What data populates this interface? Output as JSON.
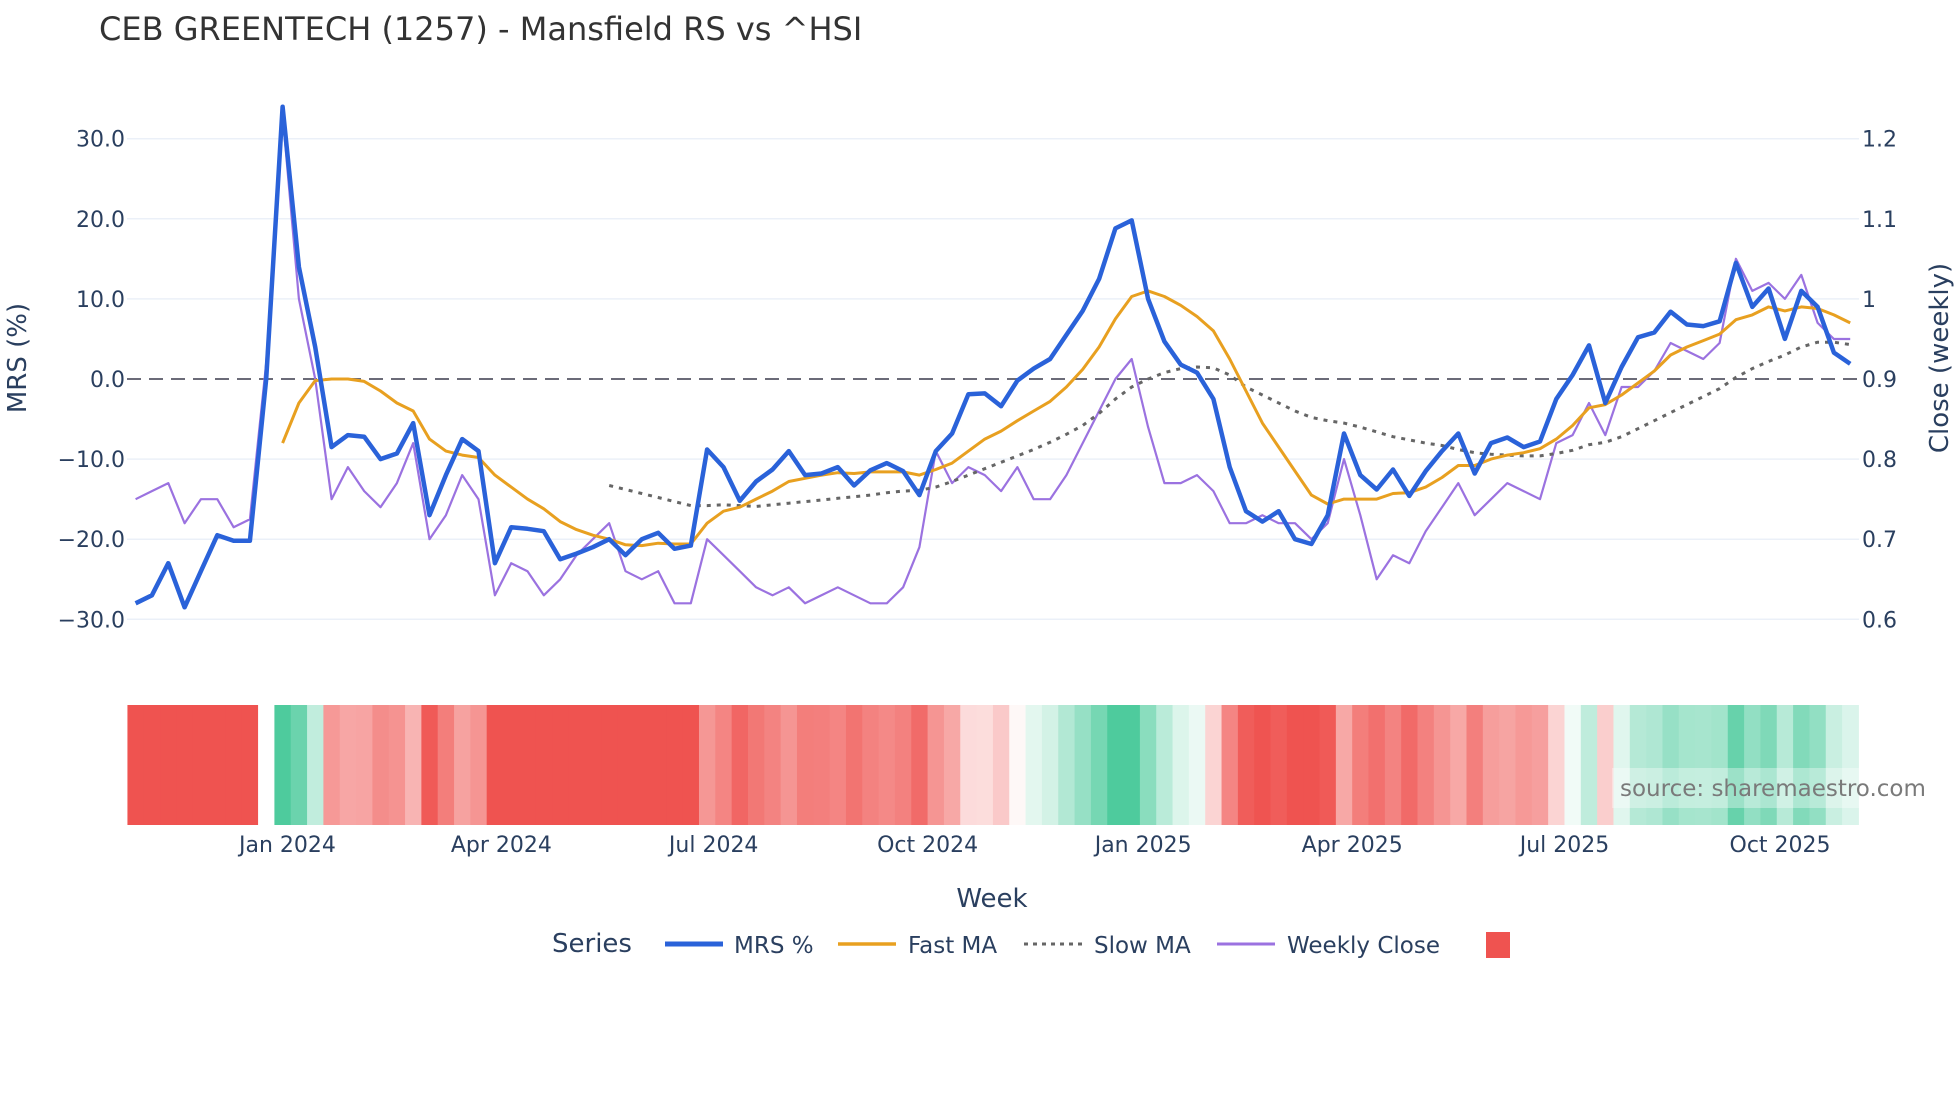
{
  "chart_data": {
    "type": "line",
    "title": "CEB GREENTECH (1257) - Mansfield RS vs ^HSI",
    "xlabel": "Week",
    "ylabel": "MRS (%)",
    "y2label": "Close (weekly)",
    "ylim": [
      -36,
      36
    ],
    "y2lim": [
      0.55,
      1.25
    ],
    "yticks": [
      "30.0",
      "20.0",
      "10.0",
      "0.0",
      "−10.0",
      "−20.0",
      "−30.0"
    ],
    "ytick_values": [
      30,
      20,
      10,
      0,
      -10,
      -20,
      -30
    ],
    "y2ticks": [
      "1.2",
      "1.1",
      "1",
      "0.9",
      "0.8",
      "0.7",
      "0.6"
    ],
    "y2tick_values": [
      1.2,
      1.1,
      1.0,
      0.9,
      0.8,
      0.7,
      0.6
    ],
    "xticks": [
      {
        "label": "Jan 2024",
        "week": 9.3
      },
      {
        "label": "Apr 2024",
        "week": 22.4
      },
      {
        "label": "Jul 2024",
        "week": 35.4
      },
      {
        "label": "Oct 2024",
        "week": 48.5
      },
      {
        "label": "Jan 2025",
        "week": 61.7
      },
      {
        "label": "Apr 2025",
        "week": 74.5
      },
      {
        "label": "Jul 2025",
        "week": 87.5
      },
      {
        "label": "Oct 2025",
        "week": 100.7
      }
    ],
    "zero_line": 0,
    "grid": true,
    "legend": {
      "title": "Series",
      "placement": "bottom-center"
    },
    "annotation": "source: sharemaestro.com",
    "series": [
      {
        "name": "MRS %",
        "color": "#2a62d9",
        "axis": "left",
        "start": 0,
        "values": [
          -28,
          -27,
          -23,
          -28.5,
          -24,
          -19.5,
          -20.2,
          -20.2,
          0,
          34,
          14,
          4,
          -8.5,
          -7,
          -7.2,
          -10,
          -9.3,
          -5.5,
          -17,
          -12,
          -7.5,
          -9,
          -23,
          -18.5,
          -18.7,
          -19,
          -22.5,
          -21.8,
          -21,
          -20,
          -22,
          -20,
          -19.2,
          -21.2,
          -20.8,
          -8.8,
          -11,
          -15.2,
          -12.8,
          -11.3,
          -9,
          -12,
          -11.8,
          -11,
          -13.3,
          -11.4,
          -10.5,
          -11.5,
          -14.5,
          -9,
          -6.8,
          -1.9,
          -1.8,
          -3.4,
          -0.2,
          1.3,
          2.5,
          5.5,
          8.5,
          12.5,
          18.8,
          19.8,
          10,
          4.7,
          1.8,
          0.8,
          -2.5,
          -11,
          -16.5,
          -17.8,
          -16.5,
          -20,
          -20.6,
          -17,
          -6.8,
          -12,
          -13.8,
          -11.3,
          -14.6,
          -11.5,
          -9,
          -6.8,
          -11.8,
          -8,
          -7.3,
          -8.5,
          -7.8,
          -2.5,
          0.5,
          4.2,
          -3,
          1.5,
          5.2,
          5.8,
          8.4,
          6.8,
          6.6,
          7.2,
          14.5,
          9,
          11.3,
          5,
          11,
          9,
          3.3,
          1.9
        ]
      },
      {
        "name": "Fast MA",
        "color": "#e8a020",
        "axis": "left",
        "start": 9,
        "values": [
          -8,
          -3,
          -0.2,
          0,
          0,
          -0.3,
          -1.5,
          -3,
          -4,
          -7.5,
          -9,
          -9.5,
          -9.8,
          -12,
          -13.5,
          -15,
          -16.2,
          -17.8,
          -18.8,
          -19.5,
          -20,
          -20.7,
          -20.8,
          -20.5,
          -20.6,
          -20.6,
          -18,
          -16.5,
          -16,
          -15,
          -14,
          -12.8,
          -12.4,
          -12,
          -11.7,
          -11.8,
          -11.6,
          -11.6,
          -11.6,
          -12,
          -11.3,
          -10.5,
          -9,
          -7.5,
          -6.5,
          -5.2,
          -4,
          -2.8,
          -1,
          1.2,
          4,
          7.5,
          10.3,
          11,
          10.3,
          9.2,
          7.8,
          6,
          2.5,
          -1.5,
          -5.5,
          -8.5,
          -11.5,
          -14.5,
          -15.6,
          -15,
          -15,
          -15,
          -14.3,
          -14.2,
          -13.5,
          -12.3,
          -10.8,
          -10.8,
          -10,
          -9.5,
          -9.2,
          -8.7,
          -7.5,
          -5.8,
          -3.6,
          -3.2,
          -2,
          -0.5,
          1,
          3,
          4,
          4.8,
          5.6,
          7.4,
          8,
          9,
          8.5,
          9,
          8.8,
          8,
          7
        ]
      },
      {
        "name": "Slow MA",
        "color": "#666666",
        "axis": "left",
        "start": 29,
        "dash": "dot",
        "values": [
          -13.3,
          -13.8,
          -14.3,
          -14.8,
          -15.3,
          -15.8,
          -15.8,
          -15.7,
          -15.8,
          -15.9,
          -15.7,
          -15.5,
          -15.3,
          -15.1,
          -14.9,
          -14.7,
          -14.5,
          -14.2,
          -14,
          -13.9,
          -13.5,
          -12.8,
          -12,
          -11.2,
          -10.4,
          -9.6,
          -8.8,
          -7.9,
          -6.9,
          -5.8,
          -4.3,
          -2.5,
          -1,
          0,
          0.8,
          1.3,
          1.5,
          1.4,
          0.5,
          -1,
          -2,
          -3,
          -4,
          -4.8,
          -5.2,
          -5.5,
          -6,
          -6.6,
          -7.2,
          -7.6,
          -8,
          -8.3,
          -8.8,
          -9.2,
          -9.4,
          -9.5,
          -9.6,
          -9.6,
          -9.3,
          -8.9,
          -8.2,
          -7.9,
          -7.2,
          -6.2,
          -5.2,
          -4.2,
          -3.2,
          -2.2,
          -1.2,
          0.2,
          1.3,
          2.2,
          3,
          4,
          4.6,
          4.6,
          4.3
        ]
      },
      {
        "name": "Weekly Close",
        "color": "#9b72e0",
        "axis": "right",
        "start": 0,
        "values": [
          0.75,
          0.76,
          0.77,
          0.72,
          0.75,
          0.75,
          0.715,
          0.725,
          0.92,
          1.23,
          1.0,
          0.9,
          0.75,
          0.79,
          0.76,
          0.74,
          0.77,
          0.82,
          0.7,
          0.73,
          0.78,
          0.75,
          0.63,
          0.67,
          0.66,
          0.63,
          0.65,
          0.68,
          0.7,
          0.72,
          0.66,
          0.65,
          0.66,
          0.62,
          0.62,
          0.7,
          0.68,
          0.66,
          0.64,
          0.63,
          0.64,
          0.62,
          0.63,
          0.64,
          0.63,
          0.62,
          0.62,
          0.64,
          0.69,
          0.81,
          0.77,
          0.79,
          0.78,
          0.76,
          0.79,
          0.75,
          0.75,
          0.78,
          0.82,
          0.86,
          0.9,
          0.925,
          0.84,
          0.77,
          0.77,
          0.78,
          0.76,
          0.72,
          0.72,
          0.73,
          0.72,
          0.72,
          0.7,
          0.72,
          0.8,
          0.73,
          0.65,
          0.68,
          0.67,
          0.71,
          0.74,
          0.77,
          0.73,
          0.75,
          0.77,
          0.76,
          0.75,
          0.82,
          0.83,
          0.87,
          0.83,
          0.89,
          0.89,
          0.91,
          0.945,
          0.935,
          0.925,
          0.945,
          1.05,
          1.01,
          1.02,
          1.0,
          1.03,
          0.97,
          0.95,
          0.95
        ]
      },
      {
        "name": "",
        "type": "heatmap",
        "color": "#ef5350",
        "source": "MRS %",
        "colorscale": [
          "#ef5350",
          "#ffffff",
          "#4ecb9d"
        ]
      }
    ]
  }
}
